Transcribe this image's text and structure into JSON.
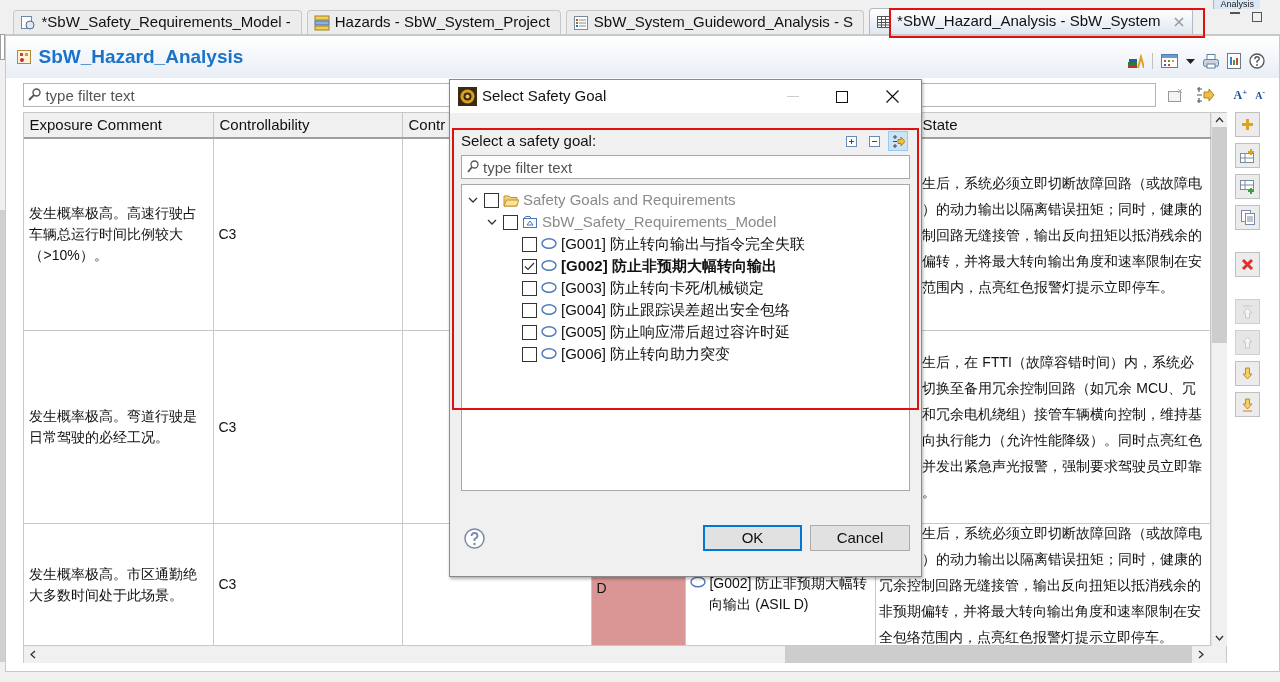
{
  "perspective": {
    "label": "Analysis"
  },
  "editor_tabs": [
    {
      "label": "*SbW_Safety_Requirements_Model -",
      "kind": "model",
      "selected": false
    },
    {
      "label": "Hazards - SbW_System_Project",
      "kind": "hazards",
      "selected": false
    },
    {
      "label": "SbW_System_Guideword_Analysis - S",
      "kind": "list",
      "selected": false
    },
    {
      "label": "*SbW_Hazard_Analysis - SbW_System",
      "kind": "table",
      "selected": true
    }
  ],
  "editor": {
    "title": "SbW_Hazard_Analysis",
    "filter": {
      "placeholder": "type filter text"
    },
    "font_buttons": [
      "A$^{+}$",
      "A$^{-}$"
    ],
    "table": {
      "columns": [
        "Exposure Comment",
        "Controllability",
        "Contr",
        "State"
      ],
      "rows": [
        {
          "exposure_comment": "发生概率极高。高速行驶占车辆总运行时间比例较大（>10%）。",
          "controllability": "C3",
          "safe_state": {
            "covered_lines": [
              "生后，系统必须立即切断故障回路（或故障电",
              "）的动力输出以隔离错误扭矩；同时，健康的",
              "制回路无缝接管，输出反向扭矩以抵消残余的",
              "偏转，并将最大转向输出角度和速率限制在安",
              "范围内，点亮红色报警灯提示立即停车。"
            ]
          }
        },
        {
          "exposure_comment": "发生概率极高。弯道行驶是日常驾驶的必经工况。",
          "controllability": "C3",
          "safe_state": {
            "covered_lines": [
              "生后，在 FTTI（故障容错时间）内，系统必",
              "切换至备用冗余控制回路（如冗余 MCU、冗",
              "和冗余电机绕组）接管车辆横向控制，维持基",
              "向执行能力（允许性能降级）。同时点亮红色",
              "并发出紧急声光报警，强制要求驾驶员立即靠",
              "。"
            ]
          }
        },
        {
          "exposure_comment": "发生概率极高。市区通勤绝大多数时间处于此场景。",
          "controllability": "C3",
          "asil": {
            "text": "D",
            "color": "#d99694"
          },
          "safety_goal": "[G002] 防止非预期大幅转向输出 (ASIL D)",
          "safe_state": {
            "covered_lines": [
              "生后，系统必须立即切断故障回路（或故障电",
              "）的动力输出以隔离错误扭矩；同时，健康的"
            ],
            "lines": [
              "冗余控制回路无缝接管，输出反向扭矩以抵消残余的",
              "非预期偏转，并将最大转向输出角度和速率限制在安",
              "全包络范围内，点亮红色报警灯提示立即停车。"
            ]
          }
        }
      ]
    }
  },
  "dialog": {
    "title": "Select Safety Goal",
    "prompt": "Select a safety goal:",
    "tools": [
      {
        "kind": "expand_all",
        "selected": false
      },
      {
        "kind": "collapse_all",
        "selected": false
      },
      {
        "kind": "link",
        "selected": true
      }
    ],
    "filter": {
      "placeholder": "type filter text"
    },
    "tree": [
      {
        "label": "Safety Goals and Requirements",
        "kind": "folder",
        "checked": false,
        "expanded": true,
        "children": [
          {
            "label": "SbW_Safety_Requirements_Model",
            "kind": "model",
            "checked": false,
            "expanded": true,
            "children": [
              {
                "label": "[G001] 防止转向输出与指令完全失联",
                "kind": "goal",
                "checked": false
              },
              {
                "label": "[G002] 防止非预期大幅转向输出",
                "kind": "goal",
                "checked": true
              },
              {
                "label": "[G003] 防止转向卡死/机械锁定",
                "kind": "goal",
                "checked": false
              },
              {
                "label": "[G004] 防止跟踪误差超出安全包络",
                "kind": "goal",
                "checked": false
              },
              {
                "label": "[G005] 防止响应滞后超过容许时延",
                "kind": "goal",
                "checked": false
              },
              {
                "label": "[G006] 防止转向助力突变",
                "kind": "goal",
                "checked": false
              }
            ]
          }
        ]
      }
    ],
    "buttons": [
      {
        "label": "OK",
        "default": true
      },
      {
        "label": "Cancel",
        "default": false
      }
    ]
  }
}
